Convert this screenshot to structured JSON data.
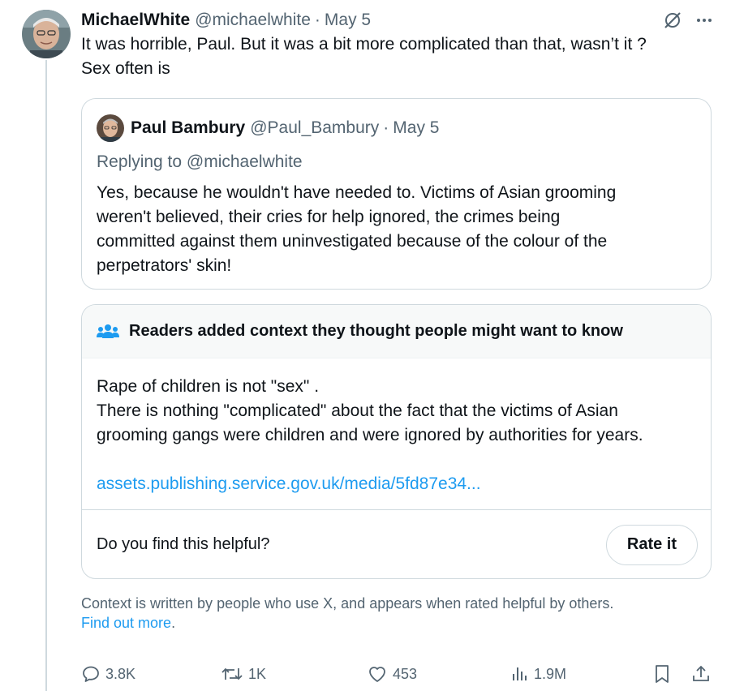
{
  "tweet": {
    "display_name": "MichaelWhite",
    "handle": "@michaelwhite",
    "separator": "·",
    "date": "May 5",
    "text_lines": [
      "It was horrible, Paul. But it was a bit more complicated than that, wasn’t it ?",
      "Sex often is"
    ]
  },
  "quote": {
    "display_name": "Paul Bambury",
    "handle": "@Paul_Bambury",
    "separator": "·",
    "date": "May 5",
    "replying_prefix": "Replying to",
    "replying_to": "@michaelwhite",
    "text_lines": [
      "Yes, because he wouldn't have needed to. Victims of Asian grooming",
      "weren't believed, their cries for help ignored, the crimes being",
      "committed against them uninvestigated because of the colour of the",
      "perpetrators' skin!"
    ]
  },
  "community_note": {
    "header": "Readers added context they thought people might want to know",
    "body_lines": [
      "Rape of children is not \"sex\" .",
      "There is nothing \"complicated\" about the fact that the victims of Asian",
      "grooming gangs were children and were ignored by authorities for years."
    ],
    "link": "assets.publishing.service.gov.uk/media/5fd87e34...",
    "question": "Do you find this helpful?",
    "rate_button": "Rate it"
  },
  "context_info": {
    "text": "Context is written by people who use X, and appears when rated helpful by others.",
    "link": "Find out more",
    "trailing": "."
  },
  "actions": {
    "replies": "3.8K",
    "reposts": "1K",
    "likes": "453",
    "views": "1.9M"
  },
  "colors": {
    "text": "#0f1419",
    "secondary": "#536471",
    "link": "#1d9bf0",
    "border": "#cfd9de",
    "note_header_bg": "#f7f9f9"
  },
  "icons": {
    "more": "more-horizontal-icon",
    "grok": "grok-icon",
    "note_people": "people-icon",
    "reply": "reply-icon",
    "repost": "repost-icon",
    "like": "heart-icon",
    "views": "views-icon",
    "bookmark": "bookmark-icon",
    "share": "share-icon"
  }
}
